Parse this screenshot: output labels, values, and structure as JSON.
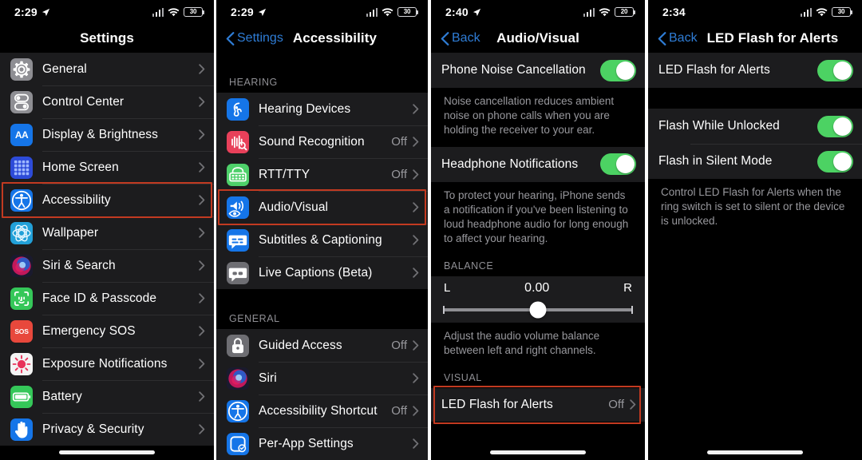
{
  "meta": {
    "accent_blue": "#2f7dd6",
    "toggle_green": "#4cd263",
    "highlight_red": "#c23a21",
    "row_bg": "#1c1c1e",
    "page_bg": "#000000",
    "secondary_text": "#98989d"
  },
  "panel1": {
    "status": {
      "time": "2:29",
      "battery_text": "30",
      "icons": [
        "location-arrow-icon",
        "cellular-bars-icon",
        "wifi-icon",
        "battery-icon"
      ]
    },
    "nav": {
      "title": "Settings"
    },
    "items": [
      {
        "label": "General",
        "icon": "gear-icon",
        "icon_bg": "#8e8e93",
        "value": "",
        "chevron": true
      },
      {
        "label": "Control Center",
        "icon": "control-center-icon",
        "icon_bg": "#8e8e93",
        "value": "",
        "chevron": true
      },
      {
        "label": "Display & Brightness",
        "icon": "display-brightness-icon",
        "icon_bg": "#1575e8",
        "value": "",
        "chevron": true
      },
      {
        "label": "Home Screen",
        "icon": "home-screen-icon",
        "icon_bg": "#2d4bd8",
        "value": "",
        "chevron": true
      },
      {
        "label": "Accessibility",
        "icon": "accessibility-icon",
        "icon_bg": "#1575e8",
        "value": "",
        "chevron": true,
        "highlighted": true
      },
      {
        "label": "Wallpaper",
        "icon": "wallpaper-icon",
        "icon_bg": "#22a0d8",
        "value": "",
        "chevron": true
      },
      {
        "label": "Siri & Search",
        "icon": "siri-icon",
        "icon_bg": "#1a1a2e",
        "value": "",
        "chevron": true
      },
      {
        "label": "Face ID & Passcode",
        "icon": "face-id-icon",
        "icon_bg": "#35c759",
        "value": "",
        "chevron": true
      },
      {
        "label": "Emergency SOS",
        "icon": "sos-icon",
        "icon_bg": "#e8483c",
        "value": "",
        "chevron": true
      },
      {
        "label": "Exposure Notifications",
        "icon": "exposure-notifications-icon",
        "icon_bg": "#f4f4f4",
        "value": "",
        "chevron": true
      },
      {
        "label": "Battery",
        "icon": "battery-icon",
        "icon_bg": "#35c759",
        "value": "",
        "chevron": true
      },
      {
        "label": "Privacy & Security",
        "icon": "privacy-hand-icon",
        "icon_bg": "#1575e8",
        "value": "",
        "chevron": true
      }
    ]
  },
  "panel2": {
    "status": {
      "time": "2:29",
      "battery_text": "30"
    },
    "nav": {
      "back_label": "Settings",
      "title": "Accessibility"
    },
    "sections": [
      {
        "header": "HEARING",
        "items": [
          {
            "label": "Hearing Devices",
            "icon": "hearing-devices-icon",
            "icon_bg": "#1575e8",
            "value": "",
            "chevron": true
          },
          {
            "label": "Sound Recognition",
            "icon": "sound-recognition-icon",
            "icon_bg": "#e8405a",
            "value": "Off",
            "chevron": true
          },
          {
            "label": "RTT/TTY",
            "icon": "rtt-tty-icon",
            "icon_bg": "#4ed06a",
            "value": "Off",
            "chevron": true
          },
          {
            "label": "Audio/Visual",
            "icon": "audio-visual-icon",
            "icon_bg": "#1575e8",
            "value": "",
            "chevron": true,
            "highlighted": true
          },
          {
            "label": "Subtitles & Captioning",
            "icon": "subtitles-icon",
            "icon_bg": "#1575e8",
            "value": "",
            "chevron": true
          },
          {
            "label": "Live Captions (Beta)",
            "icon": "live-captions-icon",
            "icon_bg": "#6e6e73",
            "value": "",
            "chevron": true
          }
        ]
      },
      {
        "header": "GENERAL",
        "items": [
          {
            "label": "Guided Access",
            "icon": "guided-access-lock-icon",
            "icon_bg": "#6e6e73",
            "value": "Off",
            "chevron": true
          },
          {
            "label": "Siri",
            "icon": "siri-icon",
            "icon_bg": "#1a1a2e",
            "value": "",
            "chevron": true
          },
          {
            "label": "Accessibility Shortcut",
            "icon": "accessibility-icon",
            "icon_bg": "#1575e8",
            "value": "Off",
            "chevron": true
          },
          {
            "label": "Per-App Settings",
            "icon": "per-app-settings-icon",
            "icon_bg": "#1575e8",
            "value": "",
            "chevron": true
          }
        ]
      }
    ]
  },
  "panel3": {
    "status": {
      "time": "2:40",
      "battery_text": "20"
    },
    "nav": {
      "back_label": "Back",
      "title": "Audio/Visual"
    },
    "blocks": [
      {
        "type": "toggle-row",
        "label": "Phone Noise Cancellation",
        "on": true
      },
      {
        "type": "footer",
        "text": "Noise cancellation reduces ambient noise on phone calls when you are holding the receiver to your ear."
      },
      {
        "type": "toggle-row",
        "label": "Headphone Notifications",
        "on": true
      },
      {
        "type": "footer",
        "text": "To protect your hearing, iPhone sends a notification if you've been listening to loud headphone audio for long enough to affect your hearing."
      },
      {
        "type": "header",
        "text": "BALANCE"
      },
      {
        "type": "balance",
        "left_label": "L",
        "value": "0.00",
        "right_label": "R",
        "position_pct": 50
      },
      {
        "type": "footer",
        "text": "Adjust the audio volume balance between left and right channels."
      },
      {
        "type": "header",
        "text": "VISUAL"
      },
      {
        "type": "nav-row",
        "label": "LED Flash for Alerts",
        "value": "Off",
        "highlighted": true
      }
    ]
  },
  "panel4": {
    "status": {
      "time": "2:34",
      "battery_text": "30"
    },
    "nav": {
      "back_label": "Back",
      "title": "LED Flash for Alerts"
    },
    "blocks": [
      {
        "type": "toggle-row",
        "label": "LED Flash for Alerts",
        "on": true
      },
      {
        "type": "spacer"
      },
      {
        "type": "toggle-row",
        "label": "Flash While Unlocked",
        "on": true
      },
      {
        "type": "toggle-row",
        "label": "Flash in Silent Mode",
        "on": true
      },
      {
        "type": "footer",
        "text": "Control LED Flash for Alerts when the ring switch is set to silent or the device is unlocked."
      }
    ]
  }
}
